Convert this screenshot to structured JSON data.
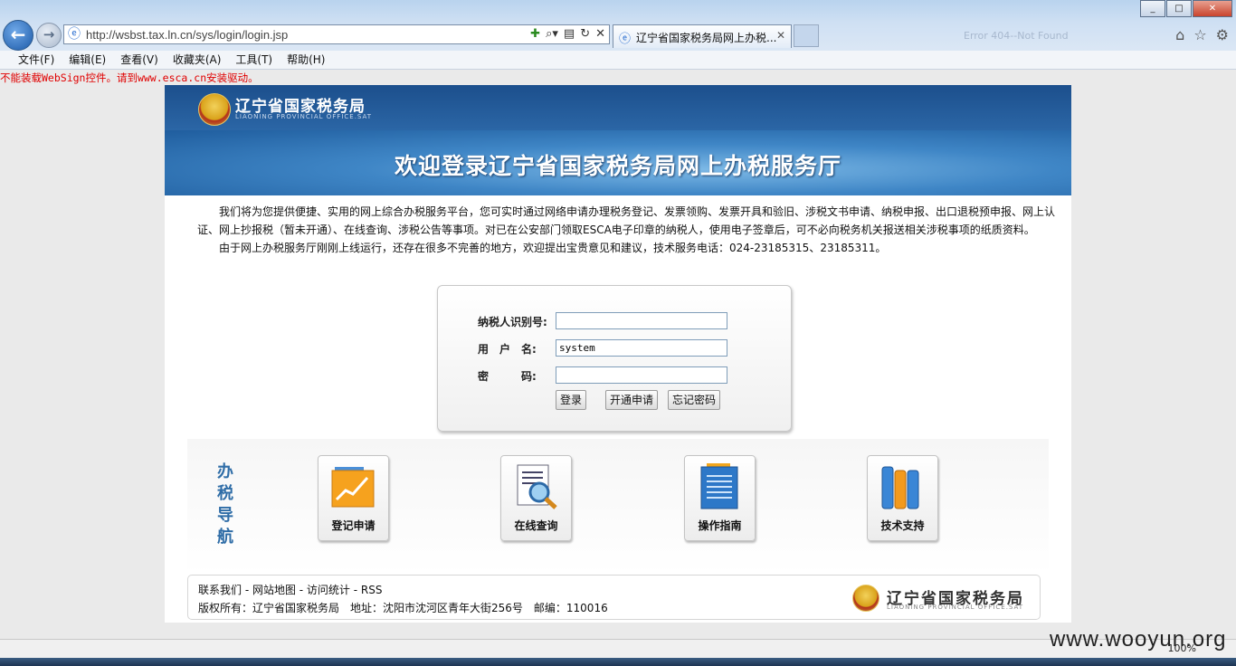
{
  "browser": {
    "url": "http://wsbst.tax.ln.cn/sys/login/login.jsp",
    "tab_title": "辽宁省国家税务局网上办税...",
    "background_tab": "Error 404--Not Found",
    "zoom": "100%",
    "menu": [
      "文件(F)",
      "编辑(E)",
      "查看(V)",
      "收藏夹(A)",
      "工具(T)",
      "帮助(H)"
    ]
  },
  "page": {
    "warning": "不能装载WebSign控件。请到www.esca.cn安装驱动。",
    "org_name": "辽宁省国家税务局",
    "org_sub": "LIAONING PROVINCIAL OFFICE.SAT",
    "banner_title": "欢迎登录辽宁省国家税务局网上办税服务厅",
    "intro_p1": "我们将为您提供便捷、实用的网上综合办税服务平台，您可实时通过网络申请办理税务登记、发票领购、发票开具和验旧、涉税文书申请、纳税申报、出口退税预申报、网上认证、网上抄报税（暂未开通）、在线查询、涉税公告等事项。对已在公安部门领取ESCA电子印章的纳税人，使用电子签章后，可不必向税务机关报送相关涉税事项的纸质资料。",
    "intro_p2": "由于网上办税服务厅刚刚上线运行，还存在很多不完善的地方，欢迎提出宝贵意见和建议，技术服务电话：024-23185315、23185311。"
  },
  "login": {
    "taxpayer_id_label": "纳税人识别号:",
    "taxpayer_id_value": "",
    "username_label": "用　户　名:",
    "username_value": "system",
    "password_label": "密　　　码:",
    "password_value": "",
    "login_button": "登录",
    "register_button": "开通申请",
    "forgot_button": "忘记密码"
  },
  "nav": {
    "title": "办税导航",
    "tiles": [
      "登记申请",
      "在线查询",
      "操作指南",
      "技术支持"
    ]
  },
  "footer": {
    "links": "联系我们 - 网站地图 - 访问统计 - RSS",
    "copyright": "版权所有：辽宁省国家税务局　地址：沈阳市沈河区青年大街256号　邮编：110016",
    "org_name": "辽宁省国家税务局",
    "org_sub": "LIAONING PROVINCIAL OFFICE.SAT"
  },
  "watermark": "www.wooyun.org",
  "colors": {
    "banner_blue": "#2b66a6",
    "warning_red": "#e00000",
    "nav_title_blue": "#2f6da7"
  }
}
